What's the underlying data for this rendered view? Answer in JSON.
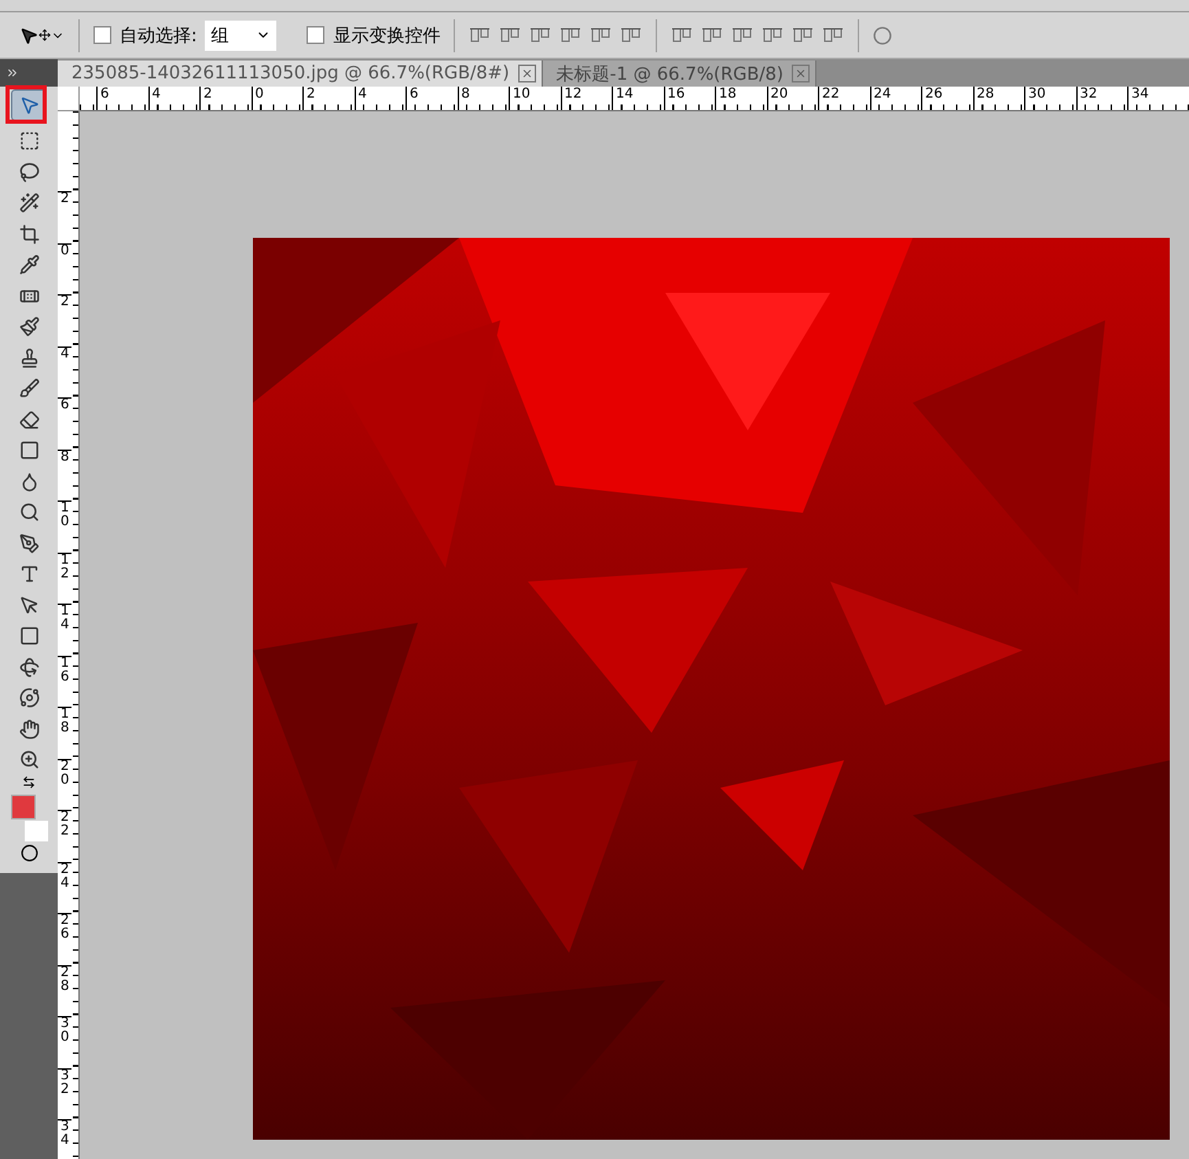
{
  "options_bar": {
    "auto_select": {
      "label": "自动选择:",
      "checked": false
    },
    "auto_select_target": {
      "value": "组"
    },
    "show_transform": {
      "label": "显示变换控件",
      "checked": false
    }
  },
  "tabs": [
    {
      "label": "235085-14032611113050.jpg @ 66.7%(RGB/8#)",
      "selected": true
    },
    {
      "label": "未标题-1 @ 66.7%(RGB/8)",
      "selected": false
    }
  ],
  "tools": [
    {
      "selected": true
    },
    {
      "selected": false
    },
    {
      "selected": false
    },
    {
      "selected": false
    },
    {
      "selected": false
    },
    {
      "selected": false
    },
    {
      "selected": false
    },
    {
      "selected": false
    },
    {
      "selected": false
    },
    {
      "selected": false
    },
    {
      "selected": false
    },
    {
      "selected": false
    },
    {
      "selected": false
    },
    {
      "selected": false
    },
    {
      "selected": false
    },
    {
      "selected": false
    },
    {
      "selected": false
    },
    {
      "selected": false
    },
    {
      "selected": false
    },
    {
      "selected": false
    },
    {
      "selected": false
    },
    {
      "selected": false
    }
  ],
  "color_swatches": [
    {
      "kind": "foreground",
      "color": "#e0393e"
    },
    {
      "kind": "background",
      "color": "#ffffff"
    }
  ],
  "horizontal_ruler": [
    "6",
    "4",
    "2",
    "0",
    "2",
    "4",
    "6",
    "8",
    "10",
    "12",
    "14",
    "16",
    "18",
    "20",
    "22",
    "24",
    "26",
    "28",
    "30",
    "32",
    "34"
  ],
  "vertical_ruler": [
    "2",
    "0",
    "2",
    "4",
    "6",
    "8",
    "10",
    "12",
    "14",
    "16",
    "18",
    "20",
    "22",
    "24",
    "26",
    "28",
    "30",
    "32",
    "34"
  ],
  "canvas": {
    "kind": "picture"
  }
}
